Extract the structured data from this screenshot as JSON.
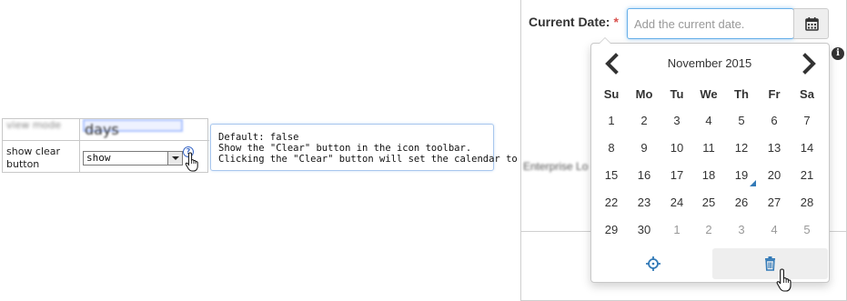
{
  "options": {
    "blurred_row_label": "view mode",
    "blurred_row_value": "days",
    "row_label": "show clear button",
    "select_value": "show",
    "help_glyph": "?",
    "tooltip_lines": [
      "Default: false",
      "Show the \"Clear\" button in the icon toolbar.",
      "Clicking the \"Clear\" button will set the calendar to null."
    ]
  },
  "form": {
    "label": "Current Date:",
    "required_mark": "*",
    "placeholder": "Add the current date.",
    "blurred_text": "Enterprise Lo",
    "info_glyph": "i"
  },
  "calendar": {
    "month_label": "November 2015",
    "weekdays": [
      "Su",
      "Mo",
      "Tu",
      "We",
      "Th",
      "Fr",
      "Sa"
    ],
    "weeks": [
      [
        {
          "d": "1"
        },
        {
          "d": "2"
        },
        {
          "d": "3"
        },
        {
          "d": "4"
        },
        {
          "d": "5"
        },
        {
          "d": "6"
        },
        {
          "d": "7"
        }
      ],
      [
        {
          "d": "8"
        },
        {
          "d": "9"
        },
        {
          "d": "10"
        },
        {
          "d": "11"
        },
        {
          "d": "12"
        },
        {
          "d": "13"
        },
        {
          "d": "14"
        }
      ],
      [
        {
          "d": "15"
        },
        {
          "d": "16"
        },
        {
          "d": "17"
        },
        {
          "d": "18"
        },
        {
          "d": "19",
          "today": true
        },
        {
          "d": "20"
        },
        {
          "d": "21"
        }
      ],
      [
        {
          "d": "22"
        },
        {
          "d": "23"
        },
        {
          "d": "24"
        },
        {
          "d": "25"
        },
        {
          "d": "26"
        },
        {
          "d": "27"
        },
        {
          "d": "28"
        }
      ],
      [
        {
          "d": "29"
        },
        {
          "d": "30"
        },
        {
          "d": "1",
          "muted": true
        },
        {
          "d": "2",
          "muted": true
        },
        {
          "d": "3",
          "muted": true
        },
        {
          "d": "4",
          "muted": true
        },
        {
          "d": "5",
          "muted": true
        }
      ]
    ],
    "today_marker_color": "#337ab7",
    "toolbar_icons": [
      "crosshairs-icon",
      "trash-icon"
    ]
  },
  "colors": {
    "accent": "#337ab7",
    "required": "#d9534f",
    "focus_border": "#66afe9",
    "tooltip_border": "#a9c7ee"
  }
}
